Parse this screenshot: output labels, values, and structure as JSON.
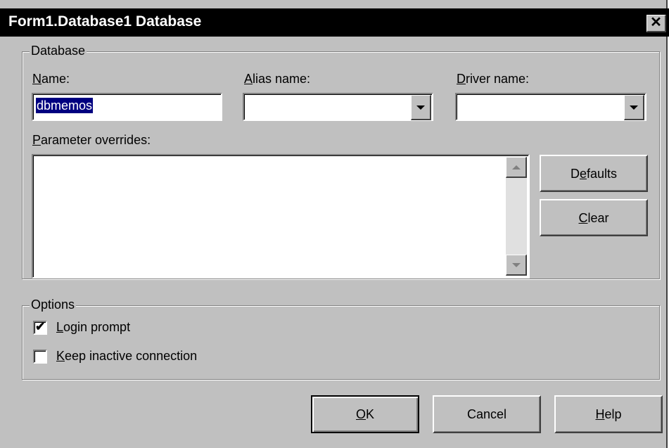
{
  "window": {
    "title": "Form1.Database1 Database",
    "close_glyph": "✕"
  },
  "database_group": {
    "legend": "Database",
    "name": {
      "accel": "N",
      "rest": "ame:",
      "value": "dbmemos"
    },
    "alias": {
      "accel": "A",
      "rest": "lias name:",
      "value": ""
    },
    "driver": {
      "accel": "D",
      "rest": "river name:",
      "value": ""
    },
    "params": {
      "accel": "P",
      "rest": "arameter overrides:",
      "value": ""
    },
    "defaults_button": {
      "pre": "D",
      "accel": "e",
      "rest": "faults"
    },
    "clear_button": {
      "pre": "",
      "accel": "C",
      "rest": "lear"
    }
  },
  "options_group": {
    "legend": "Options",
    "login_prompt": {
      "accel": "L",
      "rest": "ogin prompt",
      "checked": true
    },
    "keep_inactive": {
      "accel": "K",
      "rest": "eep inactive connection",
      "checked": false
    }
  },
  "footer": {
    "ok": {
      "accel": "O",
      "rest": "K"
    },
    "cancel": {
      "label": "Cancel"
    },
    "help": {
      "accel": "H",
      "rest": "elp"
    }
  },
  "icons": {
    "check_glyph": "✔"
  }
}
